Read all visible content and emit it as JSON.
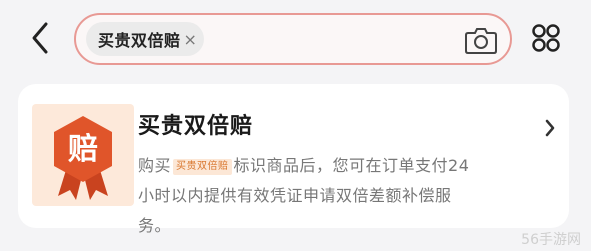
{
  "header": {
    "back_icon": "chevron-left-icon",
    "search": {
      "chip_text": "买贵双倍赔",
      "chip_close": "×"
    },
    "camera_icon": "camera-icon",
    "more_icon": "grid-dots-icon"
  },
  "card": {
    "badge_char": "赔",
    "title": "买贵双倍赔",
    "desc_prefix": "购买",
    "desc_tag": "买贵双倍赔",
    "desc_line1_rest": "标识商品后，您可在订单支付24小",
    "desc_line2": "时以内提供有效凭证申请双倍差额补偿服务。",
    "chevron_icon": "chevron-right-icon"
  },
  "watermark": "56手游网",
  "colors": {
    "accent": "#e89994",
    "badge": "#e0552a",
    "tag_bg": "#fce7d6",
    "tag_text": "#d9772f"
  }
}
